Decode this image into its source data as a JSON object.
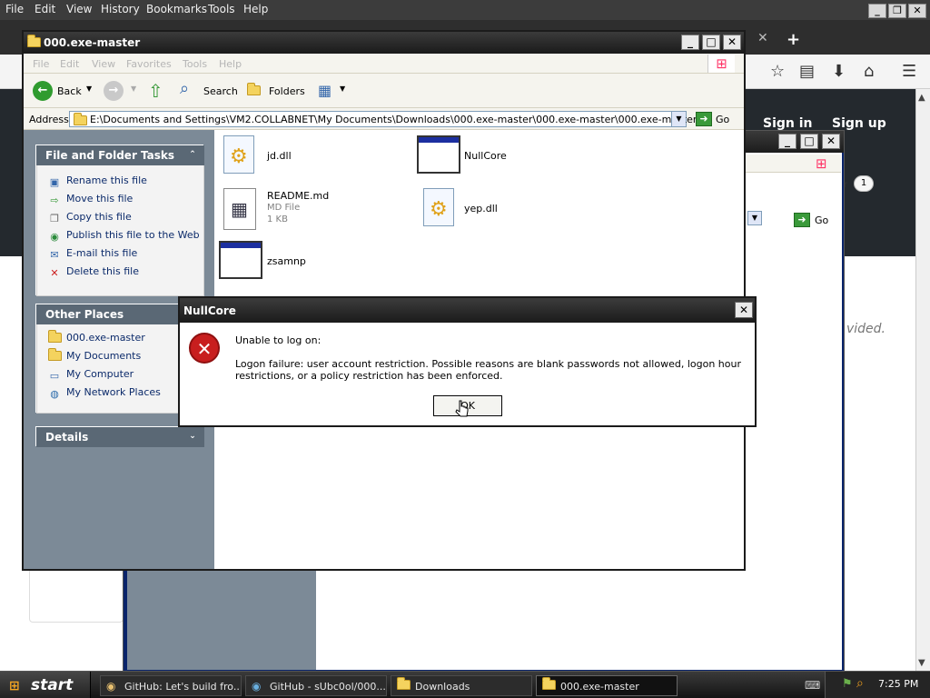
{
  "browser": {
    "menu": [
      "File",
      "Edit",
      "View",
      "History",
      "Bookmarks",
      "Tools",
      "Help"
    ],
    "header_links": {
      "sign_in": "Sign in",
      "sign_up": "Sign up"
    },
    "page_fragment": "vided."
  },
  "explorer_back": {
    "notification_count": "1",
    "r_fragment": "r",
    "go_label": "Go"
  },
  "explorer": {
    "title": "000.exe-master",
    "menu": [
      "File",
      "Edit",
      "View",
      "Favorites",
      "Tools",
      "Help"
    ],
    "toolbar": {
      "back": "Back",
      "search": "Search",
      "folders": "Folders"
    },
    "address_label": "Address",
    "address_value": "E:\\Documents and Settings\\VM2.COLLABNET\\My Documents\\Downloads\\000.exe-master\\000.exe-master\\000.exe-master",
    "go_label": "Go",
    "file_tasks": {
      "title": "File and Folder Tasks",
      "items": [
        "Rename this file",
        "Move this file",
        "Copy this file",
        "Publish this file to the Web",
        "E-mail this file",
        "Delete this file"
      ]
    },
    "other_places": {
      "title": "Other Places",
      "items": [
        "000.exe-master",
        "My Documents",
        "My Computer",
        "My Network Places"
      ]
    },
    "details": {
      "title": "Details"
    },
    "files": [
      {
        "name": "jd.dll",
        "type": "dll"
      },
      {
        "name": "NullCore",
        "type": "exe"
      },
      {
        "name": "README.md",
        "type": "doc",
        "kind": "MD File",
        "size": "1 KB"
      },
      {
        "name": "yep.dll",
        "type": "dll"
      },
      {
        "name": "zsamnp",
        "type": "exe"
      }
    ]
  },
  "dialog": {
    "title": "NullCore",
    "line1": "Unable to log on:",
    "message": "Logon failure: user account restriction.  Possible reasons are blank passwords not allowed, logon hour restrictions, or a policy restriction has been enforced.",
    "ok": "OK"
  },
  "taskbar": {
    "start": "start",
    "items": [
      "GitHub: Let's build fro...",
      "GitHub - sUbc0ol/000....",
      "Downloads",
      "000.exe-master"
    ],
    "clock": "7:25 PM"
  }
}
